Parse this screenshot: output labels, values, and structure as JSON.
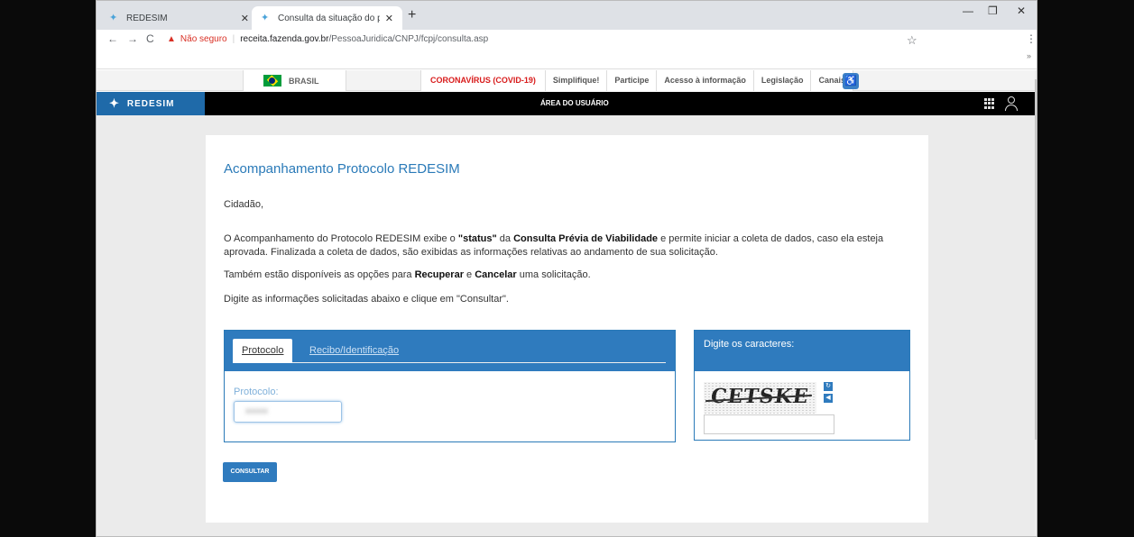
{
  "browser": {
    "tabs": [
      {
        "title": "REDESIM",
        "active": false
      },
      {
        "title": "Consulta da situação do pedido",
        "active": true
      }
    ],
    "address": {
      "security_label": "Não seguro",
      "url_host": "receita.fazenda.gov.br",
      "url_path": "/PessoaJuridica/CNPJ/fcpj/consulta.asp"
    }
  },
  "govbar": {
    "brasil_label": "BRASIL",
    "links": [
      "CORONAVÍRUS (COVID-19)",
      "Simplifique!",
      "Participe",
      "Acesso à informação",
      "Legislação",
      "Canais"
    ]
  },
  "appbar": {
    "logo_text": "REDESIM",
    "area_label": "ÁREA DO USUÁRIO"
  },
  "content": {
    "title": "Acompanhamento Protocolo REDESIM",
    "greeting": "Cidadão,",
    "para1_a": "O Acompanhamento do Protocolo REDESIM exibe o ",
    "para1_b": "\"status\"",
    "para1_c": " da ",
    "para1_d": "Consulta Prévia de Viabilidade",
    "para1_e": " e permite iniciar a coleta de dados, caso ela esteja aprovada. Finalizada a coleta de dados, são exibidas as informações relativas ao andamento de sua solicitação.",
    "para2_a": "Também estão disponíveis as opções para ",
    "para2_b": "Recuperar",
    "para2_c": " e ",
    "para2_d": "Cancelar",
    "para2_e": " uma solicitação.",
    "para3": "Digite as informações solicitadas abaixo e clique em \"Consultar\"."
  },
  "form": {
    "tab_protocolo": "Protocolo",
    "tab_recibo": "Recibo/Identificação",
    "protocolo_label": "Protocolo:",
    "protocolo_value": "xxxxx",
    "captcha_header": "Digite os caracteres:",
    "captcha_text": "CETSKE",
    "submit_label": "CONSULTAR"
  },
  "colors": {
    "accent": "#2f7bbe",
    "title": "#2a7ab8",
    "covid": "#d81b1b"
  }
}
